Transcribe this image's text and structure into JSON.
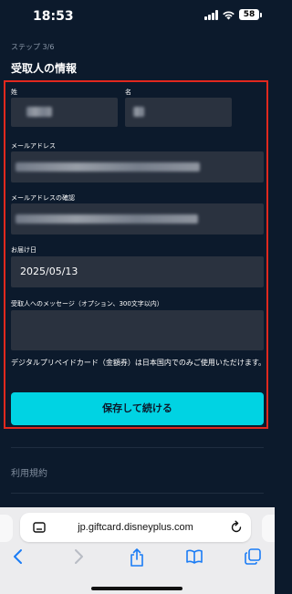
{
  "status": {
    "time": "18:53",
    "battery": "58"
  },
  "page": {
    "step": "ステップ 3/6",
    "section_title": "受取人の情報",
    "fields": {
      "last_name_label": "姓",
      "first_name_label": "名",
      "email_label": "メールアドレス",
      "email_confirm_label": "メールアドレスの確認",
      "delivery_date_label": "お届け日",
      "delivery_date_value": "2025/05/13",
      "message_label": "受取人へのメッセージ（オプション、300文字以内）"
    },
    "note": "デジタルプリペイドカード（金額券）は日本国内でのみご使用いただけます。",
    "save_button": "保存して続ける",
    "terms": "利用規約"
  },
  "browser": {
    "url": "jp.giftcard.disneyplus.com"
  },
  "colors": {
    "accent": "#00d3e3",
    "highlight": "#e1281e",
    "background": "#0c1a2c"
  }
}
